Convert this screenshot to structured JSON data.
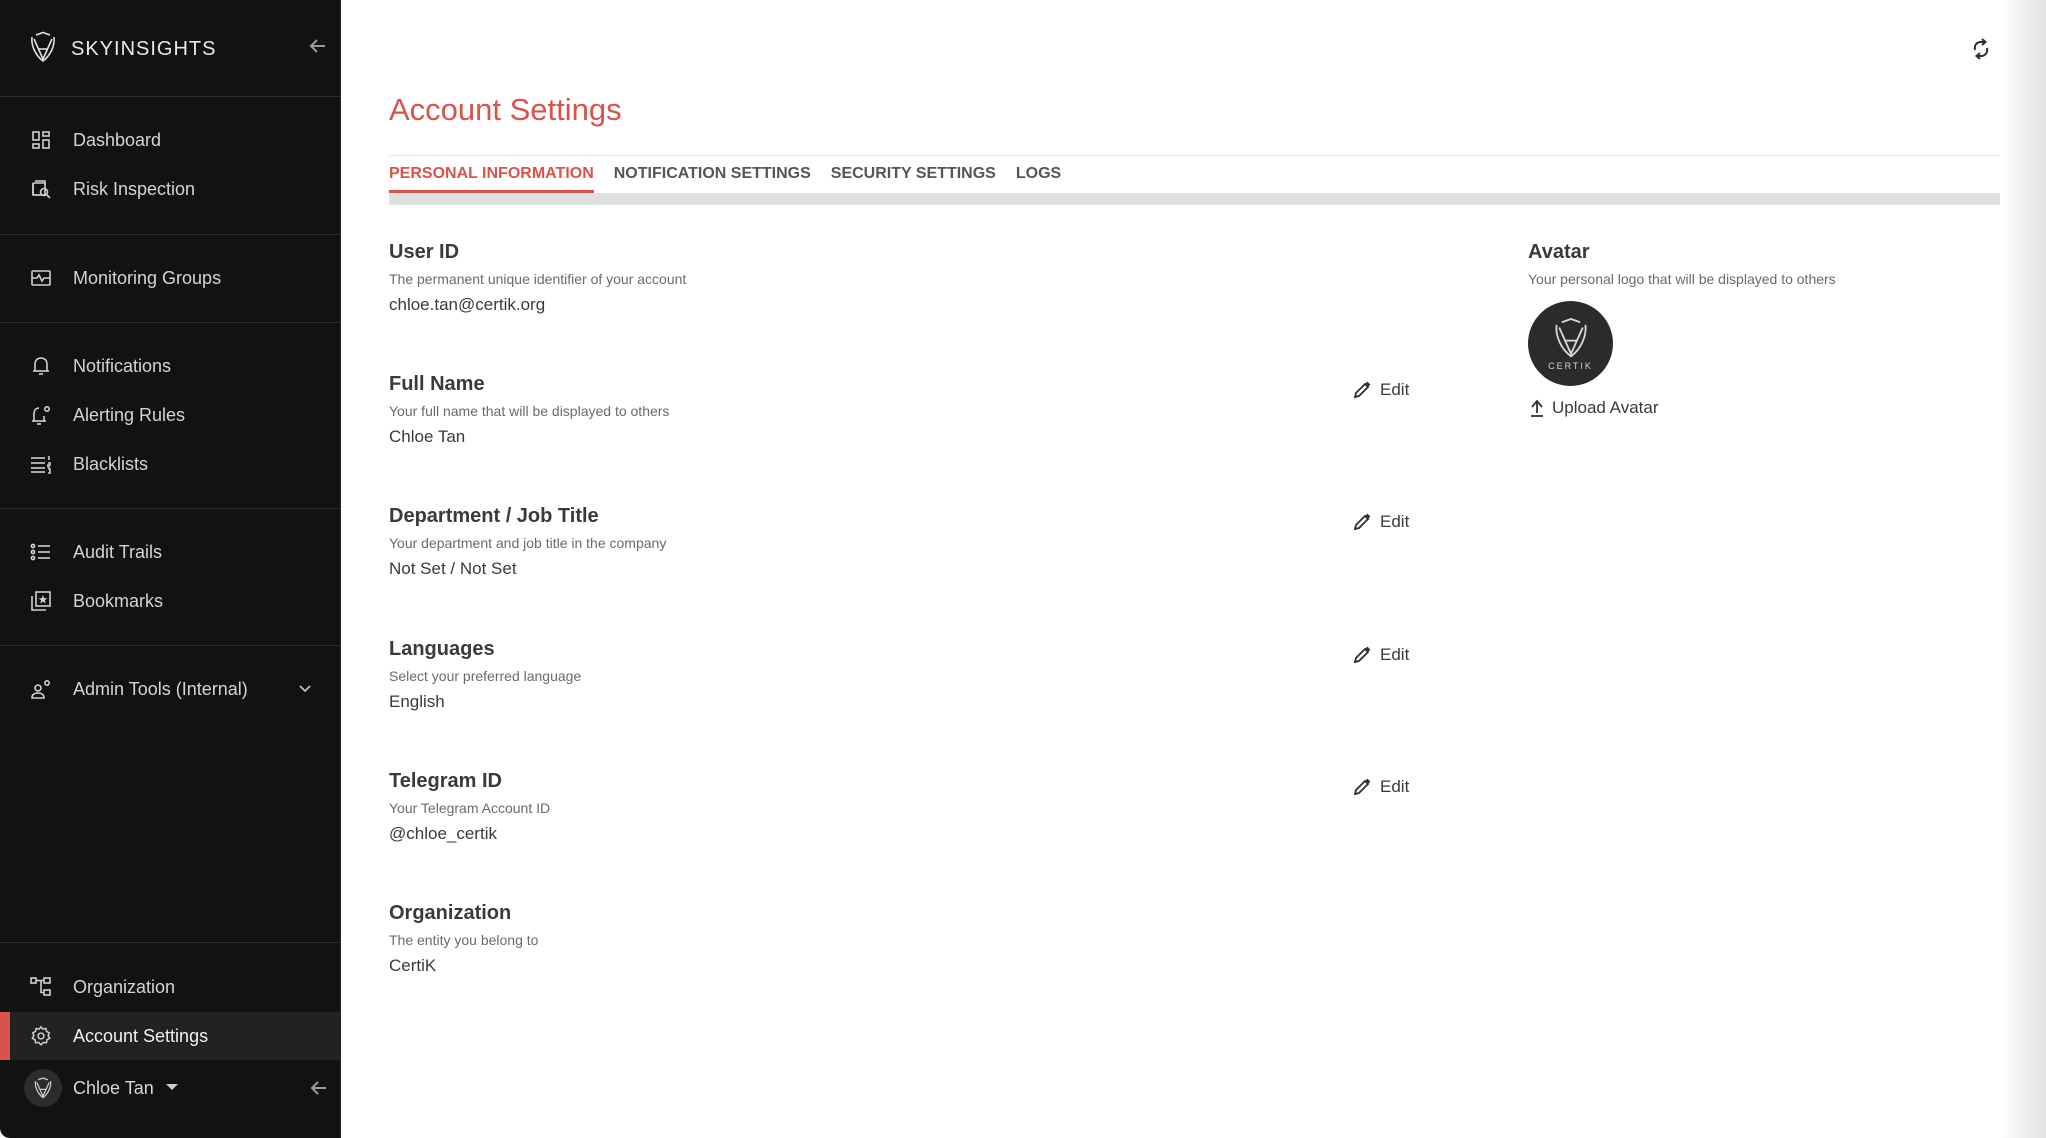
{
  "sidebar": {
    "brand": "SKYINSIGHTS",
    "groups": [
      [
        {
          "label": "Dashboard",
          "icon": "dashboard-icon"
        },
        {
          "label": "Risk Inspection",
          "icon": "risk-inspection-icon"
        }
      ],
      [
        {
          "label": "Monitoring Groups",
          "icon": "monitoring-groups-icon"
        }
      ],
      [
        {
          "label": "Notifications",
          "icon": "bell-icon"
        },
        {
          "label": "Alerting Rules",
          "icon": "alert-rule-bell-icon"
        },
        {
          "label": "Blacklists",
          "icon": "numbered-list-icon"
        }
      ],
      [
        {
          "label": "Audit Trails",
          "icon": "audit-list-icon"
        },
        {
          "label": "Bookmarks",
          "icon": "bookmark-star-icon"
        }
      ],
      [
        {
          "label": "Admin Tools (Internal)",
          "icon": "admin-user-gear-icon",
          "expandable": true
        }
      ]
    ],
    "bottom": [
      {
        "label": "Organization",
        "icon": "org-tree-icon"
      },
      {
        "label": "Account Settings",
        "icon": "gear-icon",
        "active": true
      }
    ],
    "user": {
      "name": "Chloe Tan",
      "avatar_text": "CERTIK"
    }
  },
  "main": {
    "title": "Account Settings",
    "tabs": [
      {
        "label": "PERSONAL INFORMATION",
        "active": true
      },
      {
        "label": "NOTIFICATION SETTINGS",
        "active": false
      },
      {
        "label": "SECURITY SETTINGS",
        "active": false
      },
      {
        "label": "LOGS",
        "active": false
      }
    ],
    "fields": [
      {
        "title": "User ID",
        "desc": "The permanent unique identifier of your account",
        "value": "chloe.tan@certik.org",
        "editable": false
      },
      {
        "title": "Full Name",
        "desc": "Your full name that will be displayed to others",
        "value": "Chloe Tan",
        "editable": true
      },
      {
        "title": "Department / Job Title",
        "desc": "Your department and job title in the company",
        "value": "Not Set / Not Set",
        "editable": true
      },
      {
        "title": "Languages",
        "desc": "Select your preferred language",
        "value": "English",
        "editable": true
      },
      {
        "title": "Telegram ID",
        "desc": "Your Telegram Account ID",
        "value": "@chloe_certik",
        "editable": true
      },
      {
        "title": "Organization",
        "desc": "The entity you belong to",
        "value": "CertiK",
        "editable": false
      }
    ],
    "edit_label": "Edit",
    "avatar": {
      "title": "Avatar",
      "desc": "Your personal logo that will be displayed to others",
      "logo_text": "CERTIK",
      "upload_label": "Upload Avatar"
    }
  },
  "colors": {
    "accent": "#d9534a",
    "sidebar_bg": "#121212",
    "active_item_bg": "#222222"
  }
}
